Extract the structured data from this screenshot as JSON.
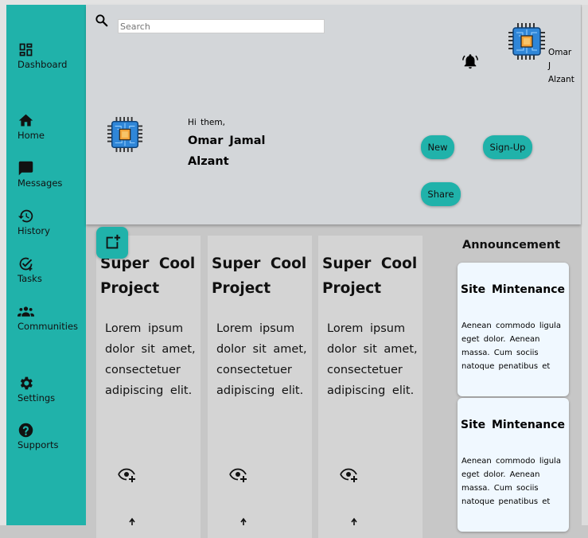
{
  "sidebar": {
    "items": [
      {
        "label": "Dashboard",
        "icon": "dashboard-icon"
      },
      {
        "label": "Home",
        "icon": "home-icon"
      },
      {
        "label": "Messages",
        "icon": "message-icon"
      },
      {
        "label": "History",
        "icon": "history-icon"
      },
      {
        "label": "Tasks",
        "icon": "task-check-icon"
      },
      {
        "label": "Communities",
        "icon": "groups-icon"
      },
      {
        "label": "Settings",
        "icon": "gear-icon"
      },
      {
        "label": "Supports",
        "icon": "help-icon"
      }
    ]
  },
  "header": {
    "search": {
      "placeholder": "Search"
    },
    "user": {
      "first": "Omar",
      "middle": "J",
      "last": "Alzant"
    },
    "greeting": "Hi them,",
    "greeting_name_line1": "Omar Jamal",
    "greeting_name_line2": "Alzant",
    "buttons": {
      "new": "New",
      "signup": "Sign-Up",
      "share": "Share"
    }
  },
  "projects": [
    {
      "title_line1": "Super Cool",
      "title_line2": "Project",
      "body": "Lorem ipsum dolor sit amet, consectetuer adipiscing elit."
    },
    {
      "title_line1": "Super Cool",
      "title_line2": "Project",
      "body": "Lorem ipsum dolor sit amet, consectetuer adipiscing elit."
    },
    {
      "title_line1": "Super Cool",
      "title_line2": "Project",
      "body": "Lorem ipsum dolor sit amet, consectetuer adipiscing elit."
    }
  ],
  "announcements": {
    "title": "Announcement",
    "items": [
      {
        "title": "Site Mintenance",
        "body": "Aenean commodo ligula eget dolor. Aenean massa. Cum sociis natoque penatibus et"
      },
      {
        "title": "Site Mintenance",
        "body": "Aenean commodo ligula eget dolor. Aenean massa. Cum sociis natoque penatibus et"
      }
    ]
  },
  "colors": {
    "accent": "#20b2aa",
    "header_bg": "#d3d6d9",
    "card_bg": "#d4d4d4",
    "announcement_bg": "#f0f8ff",
    "page_bg": "#c7c7c7"
  }
}
